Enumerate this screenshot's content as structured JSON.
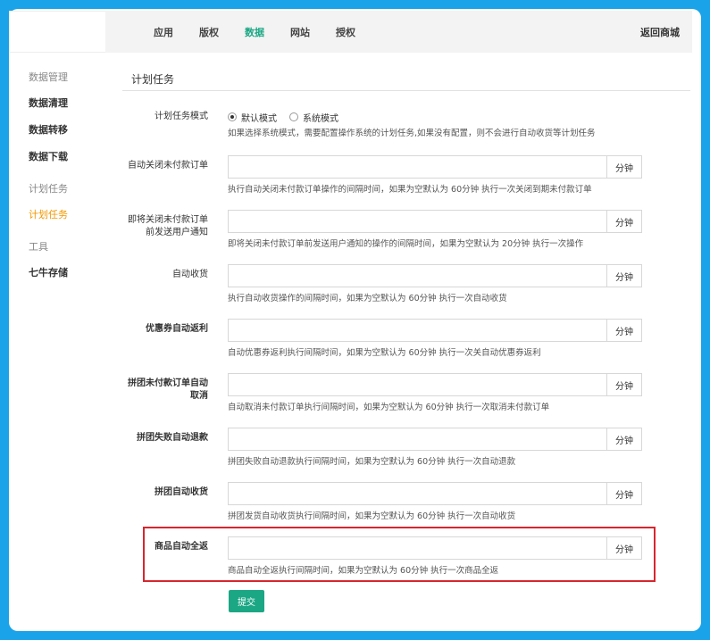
{
  "nav": {
    "items": [
      "应用",
      "版权",
      "数据",
      "网站",
      "授权"
    ],
    "active_index": 2,
    "back_label": "返回商城"
  },
  "sidebar": {
    "groups": [
      {
        "title": "数据管理",
        "items": [
          "数据清理",
          "数据转移",
          "数据下载"
        ]
      },
      {
        "title": "计划任务",
        "items": [
          "计划任务"
        ]
      },
      {
        "title": "工具",
        "items": [
          "七牛存储"
        ]
      }
    ]
  },
  "page": {
    "title": "计划任务"
  },
  "form": {
    "mode": {
      "label": "计划任务模式",
      "options": [
        "默认模式",
        "系统模式"
      ],
      "selected": "默认模式",
      "help": "如果选择系统模式，需要配置操作系统的计划任务,如果没有配置，则不会进行自动收货等计划任务"
    },
    "fields": [
      {
        "label": "自动关闭未付款订单",
        "unit": "分钟",
        "value": "",
        "help": "执行自动关闭未付款订单操作的间隔时间，如果为空默认为 60分钟 执行一次关闭到期未付款订单"
      },
      {
        "label": "即将关闭未付款订单前发送用户通知",
        "unit": "分钟",
        "value": "",
        "help": "即将关闭未付款订单前发送用户通知的操作的间隔时间，如果为空默认为 20分钟 执行一次操作"
      },
      {
        "label": "自动收货",
        "unit": "分钟",
        "value": "",
        "help": "执行自动收货操作的间隔时间，如果为空默认为 60分钟 执行一次自动收货"
      },
      {
        "label": "优惠券自动返利",
        "unit": "分钟",
        "value": "",
        "help": "自动优惠券返利执行间隔时间，如果为空默认为 60分钟 执行一次关自动优惠券返利"
      },
      {
        "label": "拼团未付款订单自动取消",
        "unit": "分钟",
        "value": "",
        "help": "自动取消未付款订单执行间隔时间，如果为空默认为 60分钟 执行一次取消未付款订单"
      },
      {
        "label": "拼团失败自动退款",
        "unit": "分钟",
        "value": "",
        "help": "拼团失败自动退款执行间隔时间，如果为空默认为 60分钟 执行一次自动退款"
      },
      {
        "label": "拼团自动收货",
        "unit": "分钟",
        "value": "",
        "help": "拼团发货自动收货执行间隔时间，如果为空默认为 60分钟 执行一次自动收货"
      },
      {
        "label": "商品自动全返",
        "unit": "分钟",
        "value": "",
        "help": "商品自动全返执行间隔时间，如果为空默认为 60分钟 执行一次商品全返"
      }
    ],
    "submit_label": "提交"
  },
  "colors": {
    "accent": "#1ba784",
    "active_sidebar": "#f39800",
    "highlight": "#d7262e",
    "background": "#1aa3e8"
  }
}
